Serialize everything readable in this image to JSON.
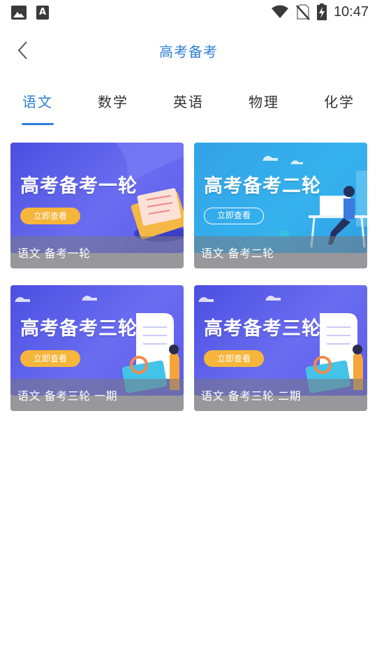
{
  "status_bar": {
    "time": "10:47",
    "left_icons": [
      "image-icon",
      "font-icon"
    ],
    "font_icon_glyph": "A",
    "right_icons": [
      "wifi-icon",
      "no-sim-icon",
      "battery-charging-icon"
    ]
  },
  "header": {
    "title": "高考备考",
    "back_icon": "chevron-left-icon"
  },
  "tabs": [
    {
      "label": "语文",
      "active": true
    },
    {
      "label": "数学",
      "active": false
    },
    {
      "label": "英语",
      "active": false
    },
    {
      "label": "物理",
      "active": false
    },
    {
      "label": "化学",
      "active": false
    }
  ],
  "colors": {
    "accent": "#2f7fd8",
    "banner_purple": "#5a5cea",
    "banner_blue": "#35b2ee",
    "button_orange": "#f6b53b"
  },
  "cards": [
    {
      "banner_title": "高考备考一轮",
      "banner_button": "立即查看",
      "caption": "语文 备考一轮"
    },
    {
      "banner_title": "高考备考二轮",
      "banner_button": "立即查看",
      "caption": "语文 备考二轮"
    },
    {
      "banner_title": "高考备考三轮",
      "banner_button": "立即查看",
      "caption": "语文 备考三轮 一期"
    },
    {
      "banner_title": "高考备考三轮",
      "banner_button": "立即查看",
      "caption": "语文 备考三轮 二期"
    }
  ]
}
